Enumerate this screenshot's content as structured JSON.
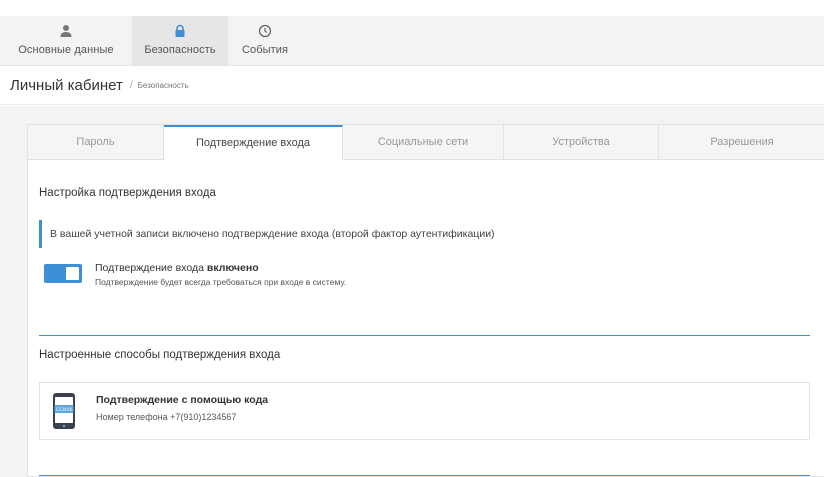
{
  "nav": {
    "items": [
      {
        "label": "Основные данные",
        "icon": "user-icon",
        "active": false
      },
      {
        "label": "Безопасность",
        "icon": "lock-icon",
        "active": true
      },
      {
        "label": "События",
        "icon": "clock-icon",
        "active": false
      }
    ]
  },
  "breadcrumb": {
    "title": "Личный кабинет",
    "separator": "/",
    "current": "Безопасность"
  },
  "tabs": [
    {
      "label": "Пароль",
      "active": false
    },
    {
      "label": "Подтверждение входа",
      "active": true
    },
    {
      "label": "Социальные сети",
      "active": false
    },
    {
      "label": "Устройства",
      "active": false
    },
    {
      "label": "Разрешения",
      "active": false
    }
  ],
  "login_confirmation": {
    "section_title": "Настройка подтверждения входа",
    "notice": "В вашей учетной записи включено подтверждение входа (второй фактор аутентификации)",
    "toggle": {
      "enabled": true,
      "title_prefix": "Подтверждение входа ",
      "title_state": "включено",
      "subtitle": "Подтверждение будет всегда требоваться при входе в систему."
    }
  },
  "methods": {
    "section_title": "Настроенные способы подтверждения входа",
    "items": [
      {
        "icon": "phone-code-icon",
        "icon_code": "123456",
        "title": "Подтверждение с помощью кода",
        "subtitle": "Номер телефона +7(910)1234567"
      }
    ]
  },
  "colors": {
    "accent": "#3e8fd6",
    "nav_bg": "#f3f3f3",
    "nav_active_bg": "#e6e6e6",
    "content_bg": "#f3f3f3"
  }
}
